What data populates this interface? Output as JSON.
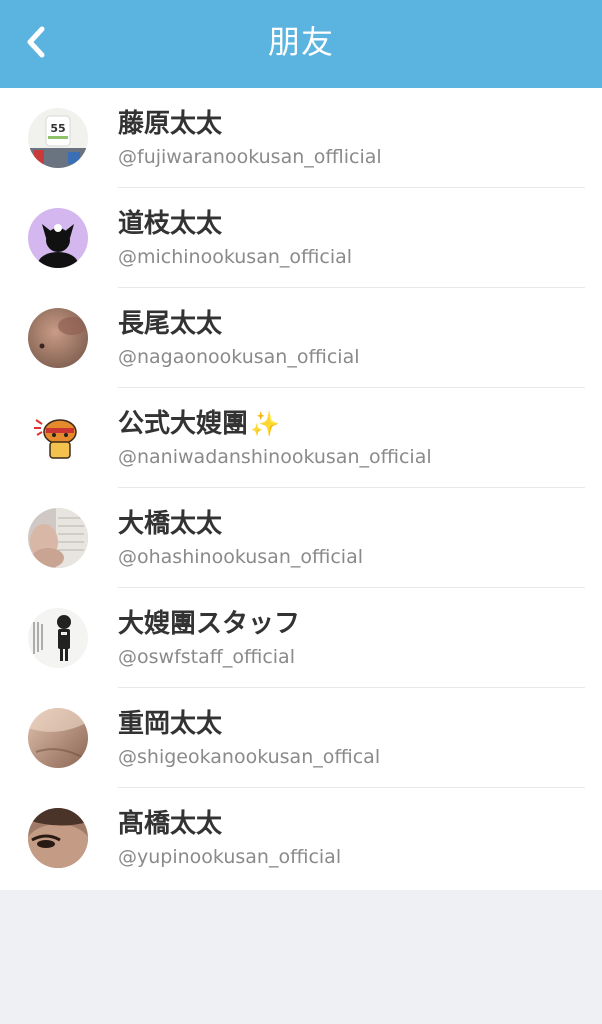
{
  "header": {
    "title": "朋友",
    "back_icon": "chevron-left-icon"
  },
  "colors": {
    "header_bg": "#5bb3df",
    "list_bg": "#ffffff",
    "page_bg": "#eef0f4",
    "name_text": "#333333",
    "handle_text": "#8a8a8a"
  },
  "friends": [
    {
      "name": "藤原太太",
      "handle": "@fujiwaranookusan_offlicial"
    },
    {
      "name": "道枝太太",
      "handle": "@michinookusan_official"
    },
    {
      "name": "長尾太太",
      "handle": "@nagaonookusan_official"
    },
    {
      "name": "公式大嫂團",
      "badge": "✨",
      "handle": "@naniwadanshinookusan_official"
    },
    {
      "name": "大橋太太",
      "handle": "@ohashinookusan_official"
    },
    {
      "name": "大嫂團スタッフ",
      "handle": "@oswfstaff_official"
    },
    {
      "name": "重岡太太",
      "handle": "@shigeokanookusan_offical"
    },
    {
      "name": "髙橋太太",
      "handle": "@yupinookusan_official"
    }
  ]
}
